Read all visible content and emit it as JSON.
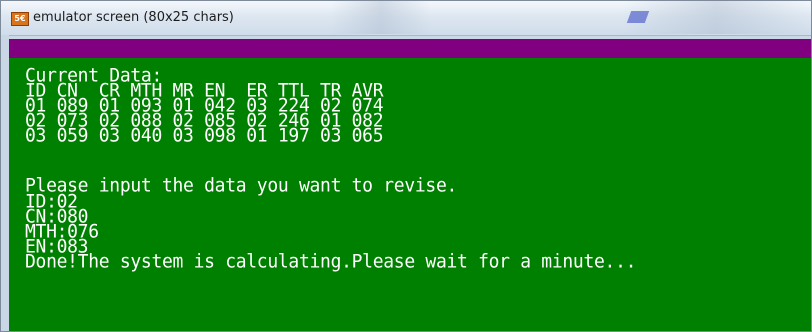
{
  "window": {
    "title": "emulator screen (80x25 chars)",
    "icon_label": "5€"
  },
  "console": {
    "lines": [
      "Current Data:",
      "ID CN  CR MTH MR EN  ER TTL TR AVR",
      "01 089 01 093 01 042 03 224 02 074",
      "02 073 02 088 02 085 02 246 01 082",
      "03 059 03 040 03 098 01 197 03 065",
      "",
      "Please input the data you want to revise.",
      "ID:02",
      "CN:080",
      "MTH:076",
      "EN:083",
      "Done!The system is calculating.Please wait for a minute..."
    ]
  },
  "colors": {
    "console_bg": "#008000",
    "console_text": "#ffffff",
    "header_bar": "#800080"
  }
}
